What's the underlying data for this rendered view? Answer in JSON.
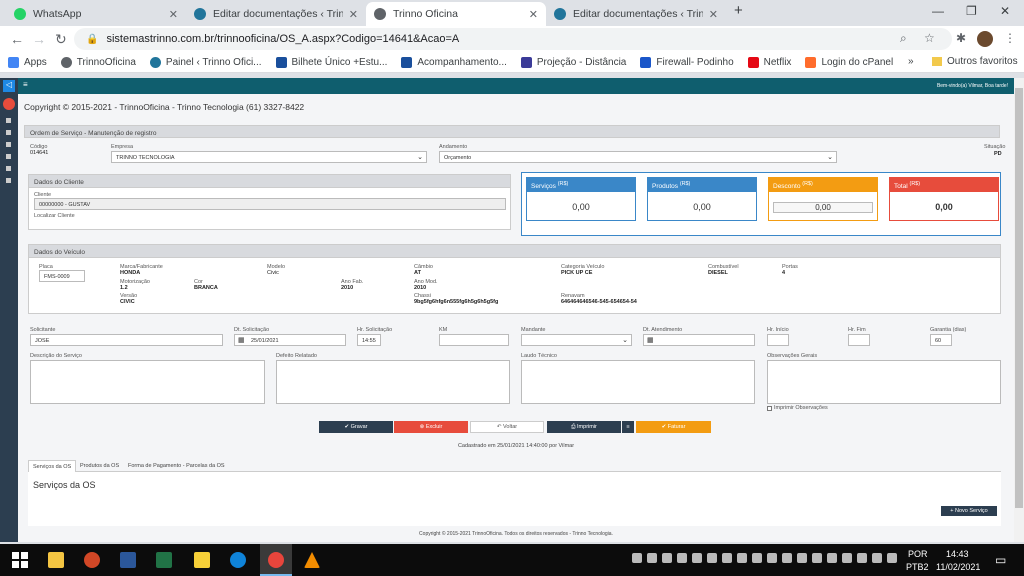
{
  "browser": {
    "tabs": [
      {
        "title": "WhatsApp",
        "color": "#25d366"
      },
      {
        "title": "Editar documentações ‹ Trinno O",
        "color": "#21759b"
      },
      {
        "title": "Trinno Oficina",
        "color": "#5f6368"
      },
      {
        "title": "Editar documentações ‹ Trinno O",
        "color": "#21759b"
      }
    ],
    "new_tab": "+",
    "url": "sistemastrinno.com.br/trinnooficina/OS_A.aspx?Codigo=14641&Acao=A",
    "bookmarks": [
      {
        "label": "Apps",
        "color": "#4285f4"
      },
      {
        "label": "TrinnoOficina",
        "color": "#5f6368"
      },
      {
        "label": "Painel ‹ Trinno Ofici...",
        "color": "#21759b"
      },
      {
        "label": "Bilhete Único +Estu...",
        "color": "#1a4f9c"
      },
      {
        "label": "Acompanhamento...",
        "color": "#1a4f9c"
      },
      {
        "label": "Projeção - Distância",
        "color": "#3b3b98"
      },
      {
        "label": "Firewall- Podinho",
        "color": "#1a56c9"
      },
      {
        "label": "Netflix",
        "color": "#e50914"
      },
      {
        "label": "Login do cPanel",
        "color": "#ff6c2c"
      }
    ],
    "bookmarks_more": "»",
    "other_favorites": "Outros favoritos"
  },
  "app": {
    "topbar_user": "Bem-vindo(a) Vilmar, Boa tarde!",
    "copyright_header": "Copyright © 2015-2021 - TrinnoOficina - Trinno Tecnologia (61) 3327-8422",
    "section_title": "Ordem de Serviço - Manutenção de registro",
    "codigo_label": "Código",
    "codigo_value": "014641",
    "empresa_label": "Empresa",
    "empresa_value": "TRINNO TECNOLOGIA",
    "andamento_label": "Andamento",
    "andamento_value": "Orçamento",
    "situacao_label": "Situação",
    "situacao_value": "PD",
    "cliente_panel": "Dados do Cliente",
    "cliente_label": "Cliente",
    "cliente_value": "00000000 - GUSTAV",
    "localizar_cliente": "Localizar Cliente",
    "totals": [
      {
        "label": "Serviços",
        "suffix": "(R$)",
        "value": "0,00",
        "color": "#3a87c8"
      },
      {
        "label": "Produtos",
        "suffix": "(R$)",
        "value": "0,00",
        "color": "#3a87c8"
      },
      {
        "label": "Desconto",
        "suffix": "(R$)",
        "value": "0,00",
        "color": "#f39c12"
      },
      {
        "label": "Total",
        "suffix": "(R$)",
        "value": "0,00",
        "color": "#e74c3c"
      }
    ],
    "veiculo_panel": "Dados do Veículo",
    "placa_label": "Placa",
    "placa_value": "FMS-0009",
    "vehicle": {
      "marca_label": "Marca/Fabricante",
      "marca_value": "HONDA",
      "modelo_label": "Modelo",
      "modelo_value": "Civic",
      "cambio_label": "Câmbio",
      "cambio_value": "AT",
      "categoria_label": "Categoria Veículo",
      "categoria_value": "PICK UP CE",
      "combustivel_label": "Combustível",
      "combustivel_value": "DIESEL",
      "portas_label": "Portas",
      "portas_value": "4",
      "motorizacao_label": "Motorização",
      "motorizacao_value": "1.2",
      "cor_label": "Cor",
      "cor_value": "BRANCA",
      "anofab_label": "Ano Fab.",
      "anofab_value": "2010",
      "anomod_label": "Ano Mod.",
      "anomod_value": "2010",
      "versao_label": "Versão",
      "versao_value": "CIVIC",
      "chassi_label": "Chassi",
      "chassi_value": "9bg5fg6hfg6n555fg6h5g6h5g5fg",
      "renavam_label": "Renavam",
      "renavam_value": "646464646546-545-654654-54"
    },
    "form": {
      "solicitante_label": "Solicitante",
      "solicitante_value": "JOSE",
      "dt_solic_label": "Dt. Solicitação",
      "dt_solic_value": "25/01/2021",
      "hr_solic_label": "Hr. Solicitação",
      "hr_solic_value": "14:55",
      "km_label": "KM",
      "km_value": "",
      "mandante_label": "Mandante",
      "mandante_value": "",
      "dt_atend_label": "Dt. Atendimento",
      "dt_atend_value": "",
      "hr_inicio_label": "Hr. Início",
      "hr_inicio_value": "",
      "hr_fim_label": "Hr. Fim",
      "hr_fim_value": "",
      "garantia_label": "Garantia (dias)",
      "garantia_value": "60",
      "descricao_label": "Descrição do Serviço",
      "defeito_label": "Defeito Relatado",
      "laudo_label": "Laudo Técnico",
      "obs_label": "Observações Gerais",
      "imprimir_obs": "Imprimir Observações"
    },
    "buttons": {
      "gravar": "Gravar",
      "excluir": "Excluir",
      "voltar": "Voltar",
      "imprimir": "Imprimir",
      "menu": "≡",
      "faturar": "Faturar"
    },
    "cadastrado": "Cadastrado em 25/01/2021 14:40:00 por Vilmar",
    "tabs": [
      "Serviços da OS",
      "Produtos da OS",
      "Forma de Pagamento - Parcelas da OS"
    ],
    "servicos_heading": "Serviços da OS",
    "novo_servico": "Novo Serviço",
    "footer": "Copyright © 2015-2021 TrinnoOficina. Todos os direitos reservados - Trinno Tecnologia."
  },
  "taskbar": {
    "lang": "POR",
    "kbd": "PTB2",
    "time": "14:43",
    "date": "11/02/2021",
    "icons": [
      "windows-start",
      "search",
      "task-view",
      "file-explorer",
      "powerpoint",
      "word",
      "excel",
      "sticky-notes",
      "edge",
      "chrome",
      "vlc"
    ]
  }
}
